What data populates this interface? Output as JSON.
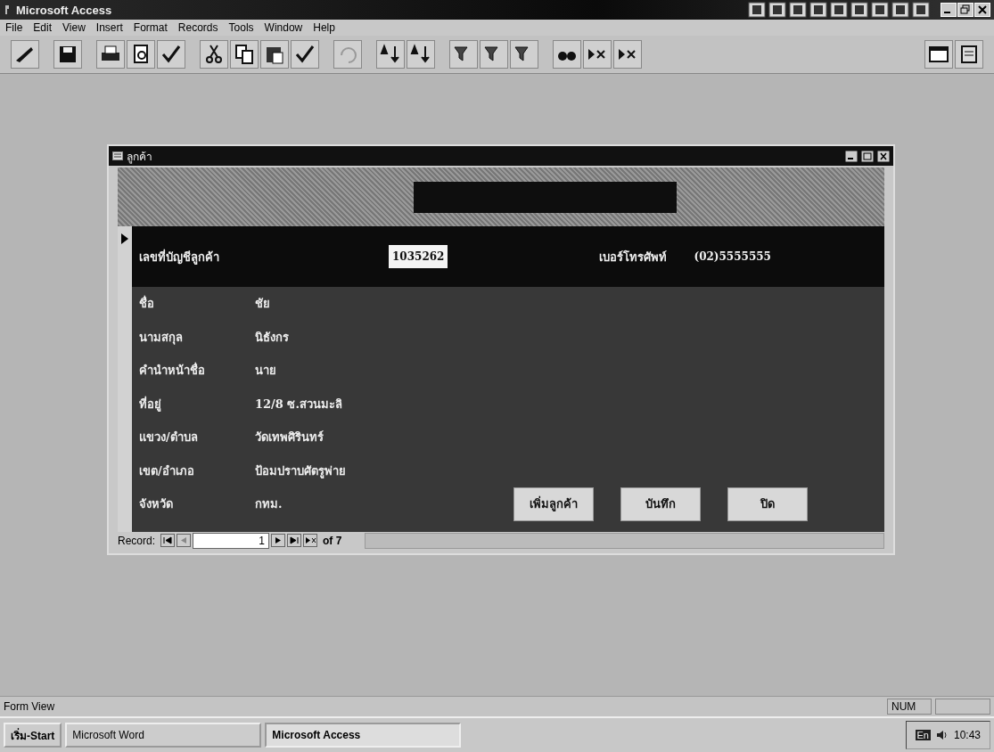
{
  "app": {
    "title": "Microsoft Access"
  },
  "menu": [
    "File",
    "Edit",
    "View",
    "Insert",
    "Format",
    "Records",
    "Tools",
    "Window",
    "Help"
  ],
  "form": {
    "title": "ลูกค้า",
    "account": {
      "label": "เลขที่บัญชีลูกค้า",
      "value": "1035262"
    },
    "phone": {
      "label": "เบอร์โทรศัพท์",
      "value": "(02)5555555"
    },
    "fields": [
      {
        "label": "ชื่อ",
        "value": "ชัย"
      },
      {
        "label": "นามสกุล",
        "value": "นิธังกร"
      },
      {
        "label": "คำนำหน้าชื่อ",
        "value": "นาย"
      },
      {
        "label": "ที่อยู่",
        "value": "12/8 ซ.สวนมะลิ"
      },
      {
        "label": "แขวง/ตำบล",
        "value": "วัดเทพศิรินทร์"
      },
      {
        "label": "เขต/อำเภอ",
        "value": "ป้อมปราบศัตรูพ่าย"
      },
      {
        "label": "จังหวัด",
        "value": "กทม."
      }
    ],
    "buttons": [
      "เพิ่มลูกค้า",
      "บันทึก",
      "ปิด"
    ],
    "navigator": {
      "label": "Record:",
      "current": "1",
      "total": "of 7"
    }
  },
  "status_bar": {
    "mode": "Form View",
    "indicator": "NUM"
  },
  "taskbar": {
    "start": "เริ่ม-Start",
    "tasks": [
      {
        "label": "Microsoft Word",
        "selected": false
      },
      {
        "label": "Microsoft Access",
        "selected": true
      }
    ],
    "language": "En",
    "clock": "10:43"
  }
}
